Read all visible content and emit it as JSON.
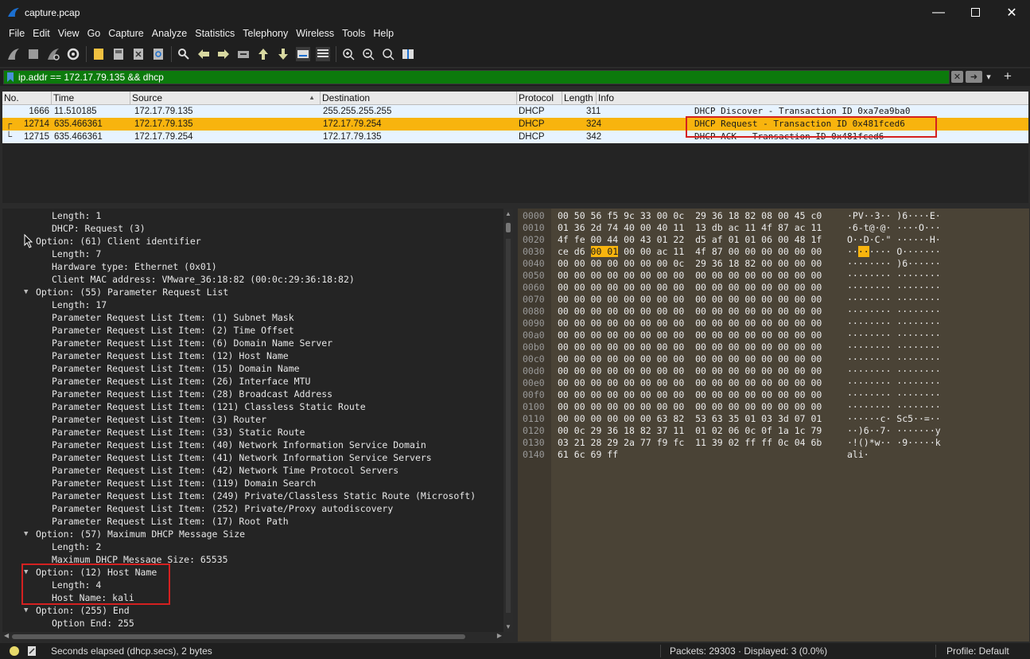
{
  "window": {
    "title": "capture.pcap"
  },
  "menu": [
    "File",
    "Edit",
    "View",
    "Go",
    "Capture",
    "Analyze",
    "Statistics",
    "Telephony",
    "Wireless",
    "Tools",
    "Help"
  ],
  "filter": {
    "value": "ip.addr == 172.17.79.135 && dhcp"
  },
  "packet_list": {
    "columns": [
      "No.",
      "Time",
      "Source",
      "Destination",
      "Protocol",
      "Length",
      "Info"
    ],
    "rows": [
      {
        "no": "1666",
        "time": "11.510185",
        "source": "172.17.79.135",
        "destination": "255.255.255.255",
        "protocol": "DHCP",
        "length": "311",
        "info": "DHCP Discover - Transaction ID 0xa7ea9ba0"
      },
      {
        "no": "12714",
        "time": "635.466361",
        "source": "172.17.79.135",
        "destination": "172.17.79.254",
        "protocol": "DHCP",
        "length": "324",
        "info": "DHCP Request  - Transaction ID 0x481fced6"
      },
      {
        "no": "12715",
        "time": "635.466361",
        "source": "172.17.79.254",
        "destination": "172.17.79.135",
        "protocol": "DHCP",
        "length": "342",
        "info": "DHCP ACK      - Transaction ID 0x481fced6"
      }
    ]
  },
  "details": [
    {
      "indent": 3,
      "text": "Length: 1"
    },
    {
      "indent": 3,
      "text": "DHCP: Request (3)"
    },
    {
      "indent": 2,
      "text": "Option: (61) Client identifier"
    },
    {
      "indent": 3,
      "text": "Length: 7"
    },
    {
      "indent": 3,
      "text": "Hardware type: Ethernet (0x01)"
    },
    {
      "indent": 3,
      "text": "Client MAC address: VMware_36:18:82 (00:0c:29:36:18:82)"
    },
    {
      "indent": 2,
      "text": "Option: (55) Parameter Request List",
      "arrow": true
    },
    {
      "indent": 3,
      "text": "Length: 17"
    },
    {
      "indent": 3,
      "text": "Parameter Request List Item: (1) Subnet Mask"
    },
    {
      "indent": 3,
      "text": "Parameter Request List Item: (2) Time Offset"
    },
    {
      "indent": 3,
      "text": "Parameter Request List Item: (6) Domain Name Server"
    },
    {
      "indent": 3,
      "text": "Parameter Request List Item: (12) Host Name"
    },
    {
      "indent": 3,
      "text": "Parameter Request List Item: (15) Domain Name"
    },
    {
      "indent": 3,
      "text": "Parameter Request List Item: (26) Interface MTU"
    },
    {
      "indent": 3,
      "text": "Parameter Request List Item: (28) Broadcast Address"
    },
    {
      "indent": 3,
      "text": "Parameter Request List Item: (121) Classless Static Route"
    },
    {
      "indent": 3,
      "text": "Parameter Request List Item: (3) Router"
    },
    {
      "indent": 3,
      "text": "Parameter Request List Item: (33) Static Route"
    },
    {
      "indent": 3,
      "text": "Parameter Request List Item: (40) Network Information Service Domain"
    },
    {
      "indent": 3,
      "text": "Parameter Request List Item: (41) Network Information Service Servers"
    },
    {
      "indent": 3,
      "text": "Parameter Request List Item: (42) Network Time Protocol Servers"
    },
    {
      "indent": 3,
      "text": "Parameter Request List Item: (119) Domain Search"
    },
    {
      "indent": 3,
      "text": "Parameter Request List Item: (249) Private/Classless Static Route (Microsoft)"
    },
    {
      "indent": 3,
      "text": "Parameter Request List Item: (252) Private/Proxy autodiscovery"
    },
    {
      "indent": 3,
      "text": "Parameter Request List Item: (17) Root Path"
    },
    {
      "indent": 2,
      "text": "Option: (57) Maximum DHCP Message Size",
      "arrow": true
    },
    {
      "indent": 3,
      "text": "Length: 2"
    },
    {
      "indent": 3,
      "text": "Maximum DHCP Message Size: 65535"
    },
    {
      "indent": 2,
      "text": "Option: (12) Host Name",
      "arrow": true
    },
    {
      "indent": 3,
      "text": "Length: 4"
    },
    {
      "indent": 3,
      "text": "Host Name: kali"
    },
    {
      "indent": 2,
      "text": "Option: (255) End",
      "arrow": true
    },
    {
      "indent": 3,
      "text": "Option End: 255"
    }
  ],
  "bytes": [
    {
      "off": "0000",
      "hex": "00 50 56 f5 9c 33 00 0c  29 36 18 82 08 00 45 c0",
      "asc": "·PV··3·· )6····E·"
    },
    {
      "off": "0010",
      "hex": "01 36 2d 74 40 00 40 11  13 db ac 11 4f 87 ac 11",
      "asc": "·6-t@·@· ····O···"
    },
    {
      "off": "0020",
      "hex": "4f fe 00 44 00 43 01 22  d5 af 01 01 06 00 48 1f",
      "asc": "O··D·C·\" ······H·"
    },
    {
      "off": "0030",
      "hex_a": "ce d6 ",
      "hex_b": "00 01",
      "hex_c": " 00 00 ac 11  4f 87 00 00 00 00 00 00",
      "asc_a": "··",
      "asc_b": "··",
      "asc_c": "···· O·······"
    },
    {
      "off": "0040",
      "hex": "00 00 00 00 00 00 00 0c  29 36 18 82 00 00 00 00",
      "asc": "········ )6······"
    },
    {
      "off": "0050",
      "hex": "00 00 00 00 00 00 00 00  00 00 00 00 00 00 00 00",
      "asc": "········ ········"
    },
    {
      "off": "0060",
      "hex": "00 00 00 00 00 00 00 00  00 00 00 00 00 00 00 00",
      "asc": "········ ········"
    },
    {
      "off": "0070",
      "hex": "00 00 00 00 00 00 00 00  00 00 00 00 00 00 00 00",
      "asc": "········ ········"
    },
    {
      "off": "0080",
      "hex": "00 00 00 00 00 00 00 00  00 00 00 00 00 00 00 00",
      "asc": "········ ········"
    },
    {
      "off": "0090",
      "hex": "00 00 00 00 00 00 00 00  00 00 00 00 00 00 00 00",
      "asc": "········ ········"
    },
    {
      "off": "00a0",
      "hex": "00 00 00 00 00 00 00 00  00 00 00 00 00 00 00 00",
      "asc": "········ ········"
    },
    {
      "off": "00b0",
      "hex": "00 00 00 00 00 00 00 00  00 00 00 00 00 00 00 00",
      "asc": "········ ········"
    },
    {
      "off": "00c0",
      "hex": "00 00 00 00 00 00 00 00  00 00 00 00 00 00 00 00",
      "asc": "········ ········"
    },
    {
      "off": "00d0",
      "hex": "00 00 00 00 00 00 00 00  00 00 00 00 00 00 00 00",
      "asc": "········ ········"
    },
    {
      "off": "00e0",
      "hex": "00 00 00 00 00 00 00 00  00 00 00 00 00 00 00 00",
      "asc": "········ ········"
    },
    {
      "off": "00f0",
      "hex": "00 00 00 00 00 00 00 00  00 00 00 00 00 00 00 00",
      "asc": "········ ········"
    },
    {
      "off": "0100",
      "hex": "00 00 00 00 00 00 00 00  00 00 00 00 00 00 00 00",
      "asc": "········ ········"
    },
    {
      "off": "0110",
      "hex": "00 00 00 00 00 00 63 82  53 63 35 01 03 3d 07 01",
      "asc": "······c· Sc5··=··"
    },
    {
      "off": "0120",
      "hex": "00 0c 29 36 18 82 37 11  01 02 06 0c 0f 1a 1c 79",
      "asc": "··)6··7· ·······y"
    },
    {
      "off": "0130",
      "hex": "03 21 28 29 2a 77 f9 fc  11 39 02 ff ff 0c 04 6b",
      "asc": "·!()*w·· ·9·····k"
    },
    {
      "off": "0140",
      "hex": "61 6c 69 ff",
      "asc": "ali·"
    }
  ],
  "status": {
    "field": "Seconds elapsed (dhcp.secs), 2 bytes",
    "packets": "Packets: 29303 · Displayed: 3 (0.0%)",
    "profile": "Profile: Default"
  }
}
